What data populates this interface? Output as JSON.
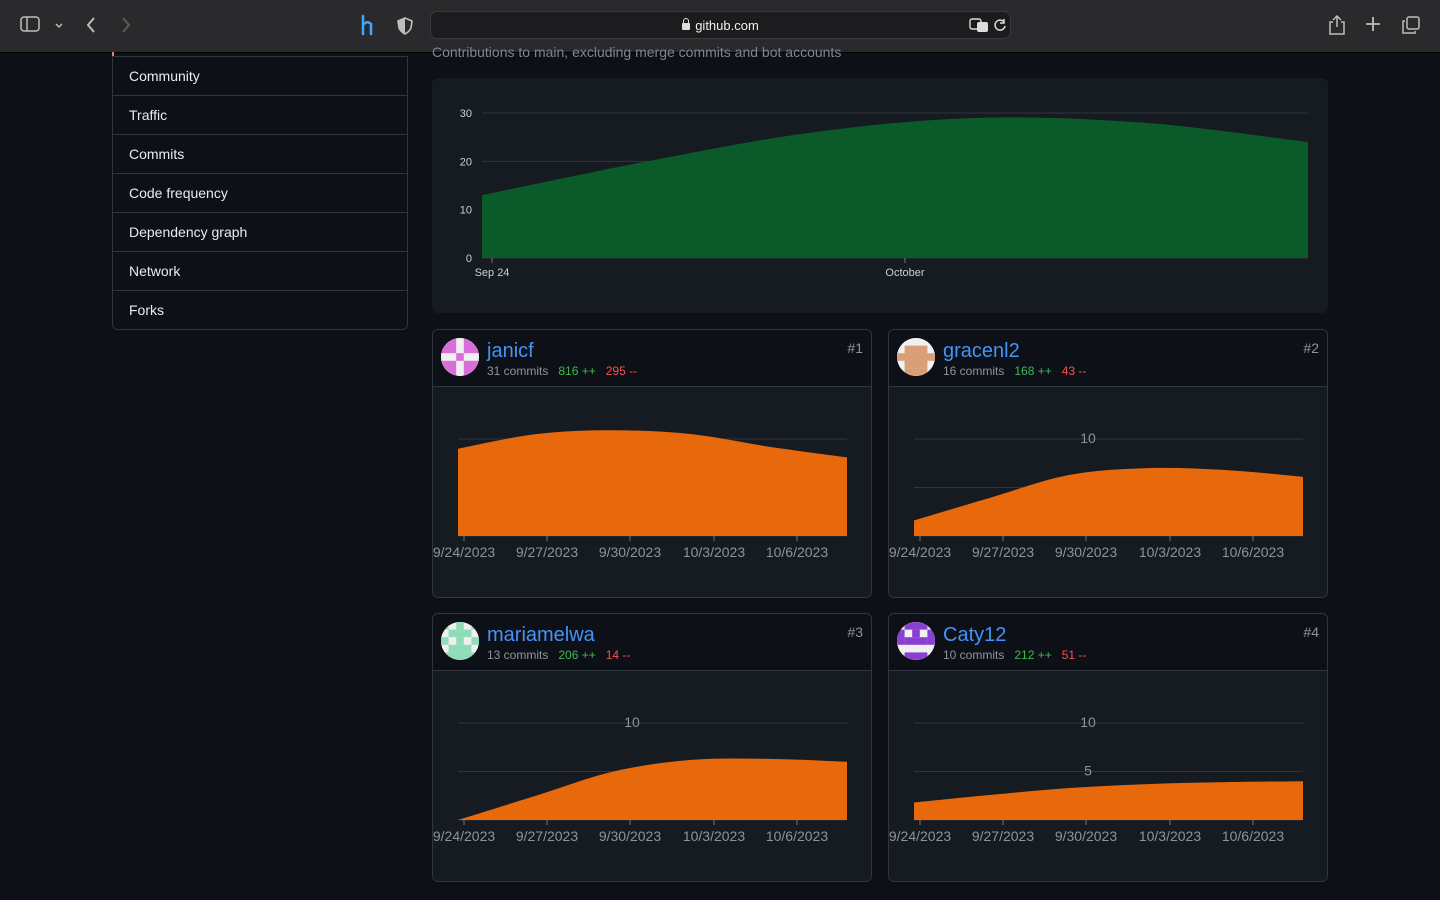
{
  "browser": {
    "url": "github.com"
  },
  "sidebar": {
    "items": [
      {
        "label": "Community"
      },
      {
        "label": "Traffic"
      },
      {
        "label": "Commits"
      },
      {
        "label": "Code frequency"
      },
      {
        "label": "Dependency graph"
      },
      {
        "label": "Network"
      },
      {
        "label": "Forks"
      }
    ]
  },
  "page": {
    "subtitle": "Contributions to main, excluding merge commits and bot accounts"
  },
  "colors": {
    "main_area": "#0b5a2a",
    "contributor_area": "#e8690b"
  },
  "chart_data": [
    {
      "type": "area",
      "name": "all-contributions",
      "x": [
        "Sep 24",
        "Sep 27",
        "Sep 30",
        "Oct 3",
        "Oct 6",
        "Oct 9"
      ],
      "tick_labels": [
        "Sep 24",
        "October"
      ],
      "y_ticks": [
        0,
        10,
        20,
        30
      ],
      "values": [
        13,
        20,
        26,
        29,
        28,
        24
      ],
      "ylim": [
        0,
        30
      ],
      "grid": true
    },
    {
      "type": "area",
      "name": "janicf",
      "x": [
        "9/24/2023",
        "9/27/2023",
        "9/30/2023",
        "10/3/2023",
        "10/6/2023",
        "10/8/2023"
      ],
      "tick_labels": [
        "9/24/2023",
        "9/27/2023",
        "9/30/2023",
        "10/3/2023",
        "10/6/2023"
      ],
      "y_ticks": [],
      "values": [
        9.0,
        10.5,
        10.9,
        10.5,
        9.2,
        8.1
      ],
      "ylim": [
        0,
        10
      ],
      "grid": true
    },
    {
      "type": "area",
      "name": "gracenl2",
      "x": [
        "9/24/2023",
        "9/27/2023",
        "9/30/2023",
        "10/3/2023",
        "10/6/2023",
        "10/8/2023"
      ],
      "tick_labels": [
        "9/24/2023",
        "9/27/2023",
        "9/30/2023",
        "10/3/2023",
        "10/6/2023"
      ],
      "y_ticks": [
        10
      ],
      "values": [
        1.6,
        4.0,
        6.3,
        7.0,
        6.8,
        6.1
      ],
      "ylim": [
        0,
        10
      ],
      "grid": true
    },
    {
      "type": "area",
      "name": "mariamelwa",
      "x": [
        "9/24/2023",
        "9/27/2023",
        "9/30/2023",
        "10/3/2023",
        "10/6/2023",
        "10/8/2023"
      ],
      "tick_labels": [
        "9/24/2023",
        "9/27/2023",
        "9/30/2023",
        "10/3/2023",
        "10/6/2023"
      ],
      "y_ticks": [
        10
      ],
      "values": [
        0,
        2.5,
        5.0,
        6.2,
        6.3,
        6.0
      ],
      "ylim": [
        0,
        10
      ],
      "grid": true
    },
    {
      "type": "area",
      "name": "Caty12",
      "x": [
        "9/24/2023",
        "9/27/2023",
        "9/30/2023",
        "10/3/2023",
        "10/6/2023",
        "10/8/2023"
      ],
      "tick_labels": [
        "9/24/2023",
        "9/27/2023",
        "9/30/2023",
        "10/3/2023",
        "10/6/2023"
      ],
      "y_ticks": [
        5,
        10
      ],
      "values": [
        1.8,
        2.6,
        3.3,
        3.7,
        3.9,
        4.0
      ],
      "ylim": [
        0,
        10
      ],
      "grid": true
    }
  ],
  "contributors": [
    {
      "username": "janicf",
      "commits": "31 commits",
      "additions": "816 ++",
      "deletions": "295 --",
      "rank": "#1"
    },
    {
      "username": "gracenl2",
      "commits": "16 commits",
      "additions": "168 ++",
      "deletions": "43 --",
      "rank": "#2"
    },
    {
      "username": "mariamelwa",
      "commits": "13 commits",
      "additions": "206 ++",
      "deletions": "14 --",
      "rank": "#3"
    },
    {
      "username": "Caty12",
      "commits": "10 commits",
      "additions": "212 ++",
      "deletions": "51 --",
      "rank": "#4"
    }
  ]
}
